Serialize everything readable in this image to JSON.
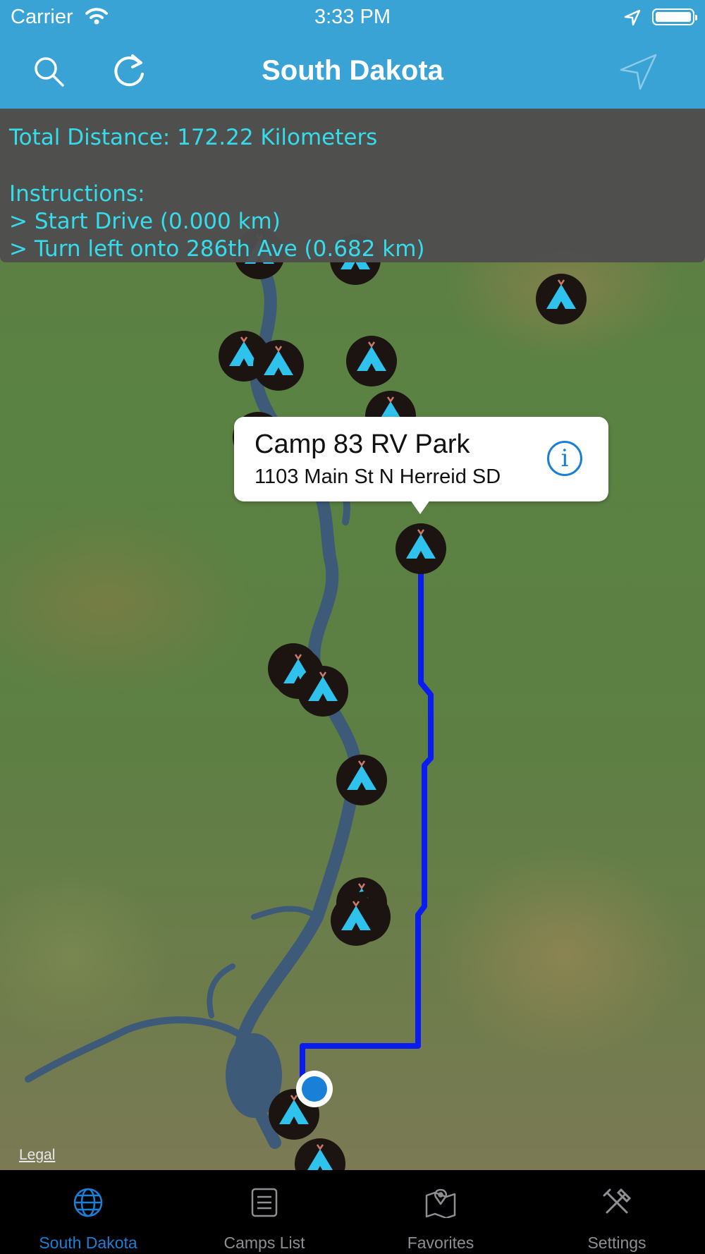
{
  "status_bar": {
    "carrier": "Carrier",
    "time": "3:33 PM"
  },
  "nav": {
    "title": "South Dakota",
    "icons": [
      "search-icon",
      "refresh-icon",
      "navigation-arrow-icon"
    ]
  },
  "route_info": {
    "total_distance": "Total Distance: 172.22 Kilometers",
    "instructions_label": "Instructions:",
    "steps": [
      "> Start Drive (0.000 km)",
      "> Turn left onto 286th Ave (0.682 km)"
    ]
  },
  "callout": {
    "title": "Camp 83 RV Park",
    "address": "1103 Main St N Herreid SD",
    "info_icon": "info-icon"
  },
  "map": {
    "legal_label": "Legal",
    "route_color": "#0b1cf0",
    "marker_icon": "tent-marker-icon",
    "accent": "#35dcec"
  },
  "tabs": [
    {
      "label": "South Dakota",
      "icon": "globe-icon",
      "active": true
    },
    {
      "label": "Camps List",
      "icon": "list-icon",
      "active": false
    },
    {
      "label": "Favorites",
      "icon": "map-pin-icon",
      "active": false
    },
    {
      "label": "Settings",
      "icon": "tools-icon",
      "active": false
    }
  ]
}
